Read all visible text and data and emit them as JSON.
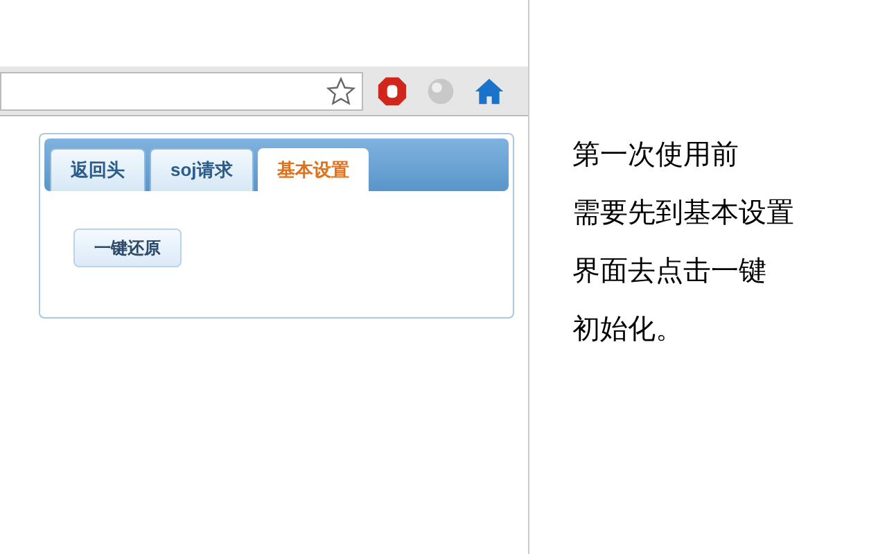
{
  "popup": {
    "tabs": [
      {
        "label": "返回头",
        "selected": false
      },
      {
        "label": "soj请求",
        "selected": false
      },
      {
        "label": "基本设置",
        "selected": true
      }
    ],
    "button": "一键还原"
  },
  "caption": [
    "第一次使用前",
    "需要先到基本设置",
    "界面去点击一键",
    "初始化。"
  ]
}
